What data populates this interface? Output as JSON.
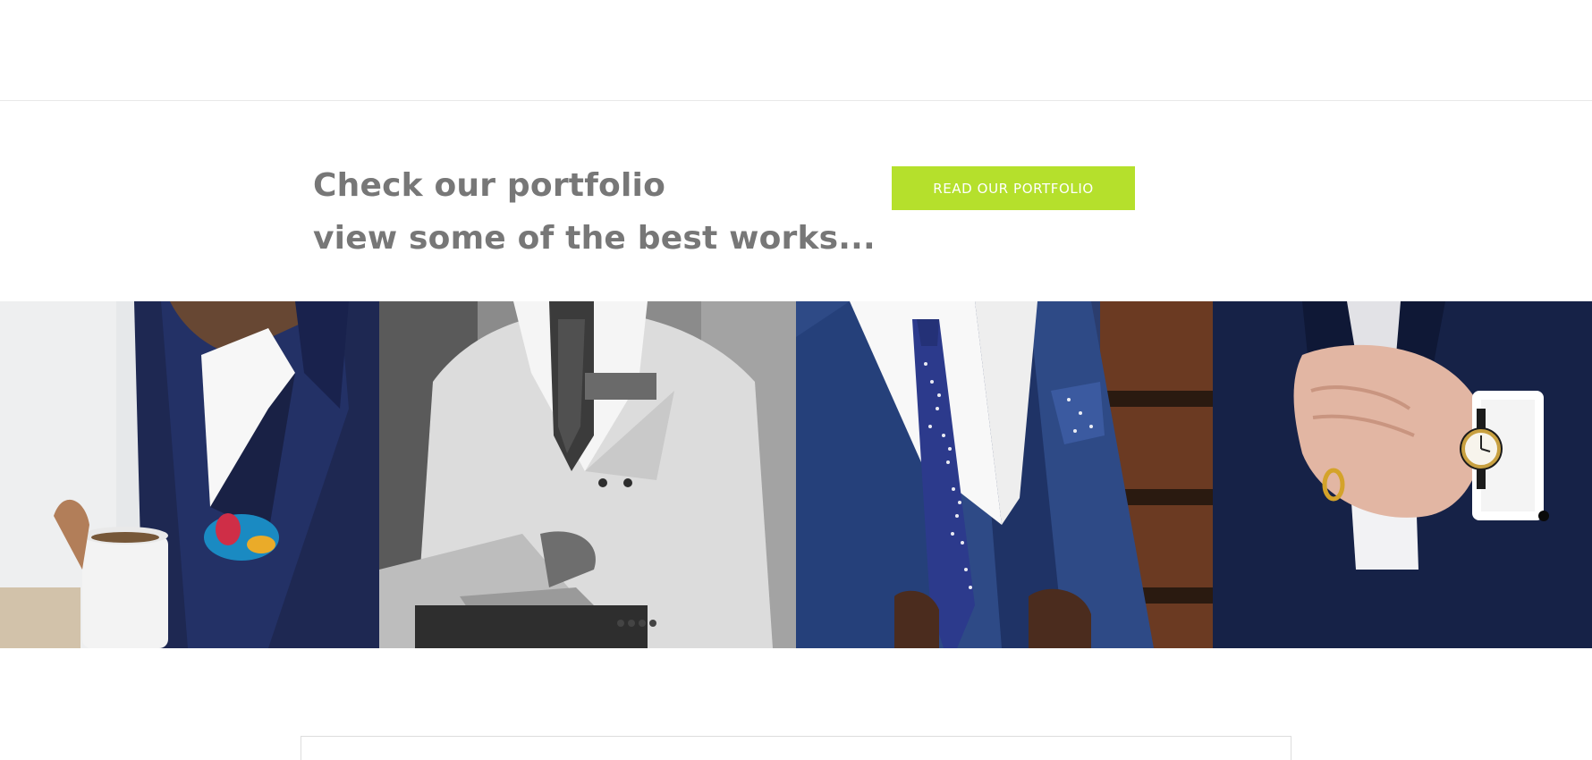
{
  "cta": {
    "heading_line1": "Check our portfolio",
    "heading_line2": "view some of the best works...",
    "button_label": "READ OUR PORTFOLIO",
    "button_color": "#b5e02c",
    "heading_color": "#777777"
  },
  "gallery": {
    "tiles": [
      {
        "name": "navy-suit-coffee-cup-photo"
      },
      {
        "name": "white-suit-laptop-photo"
      },
      {
        "name": "blue-suit-polka-dot-tie-photo"
      },
      {
        "name": "navy-suit-wristwatch-photo"
      }
    ]
  }
}
